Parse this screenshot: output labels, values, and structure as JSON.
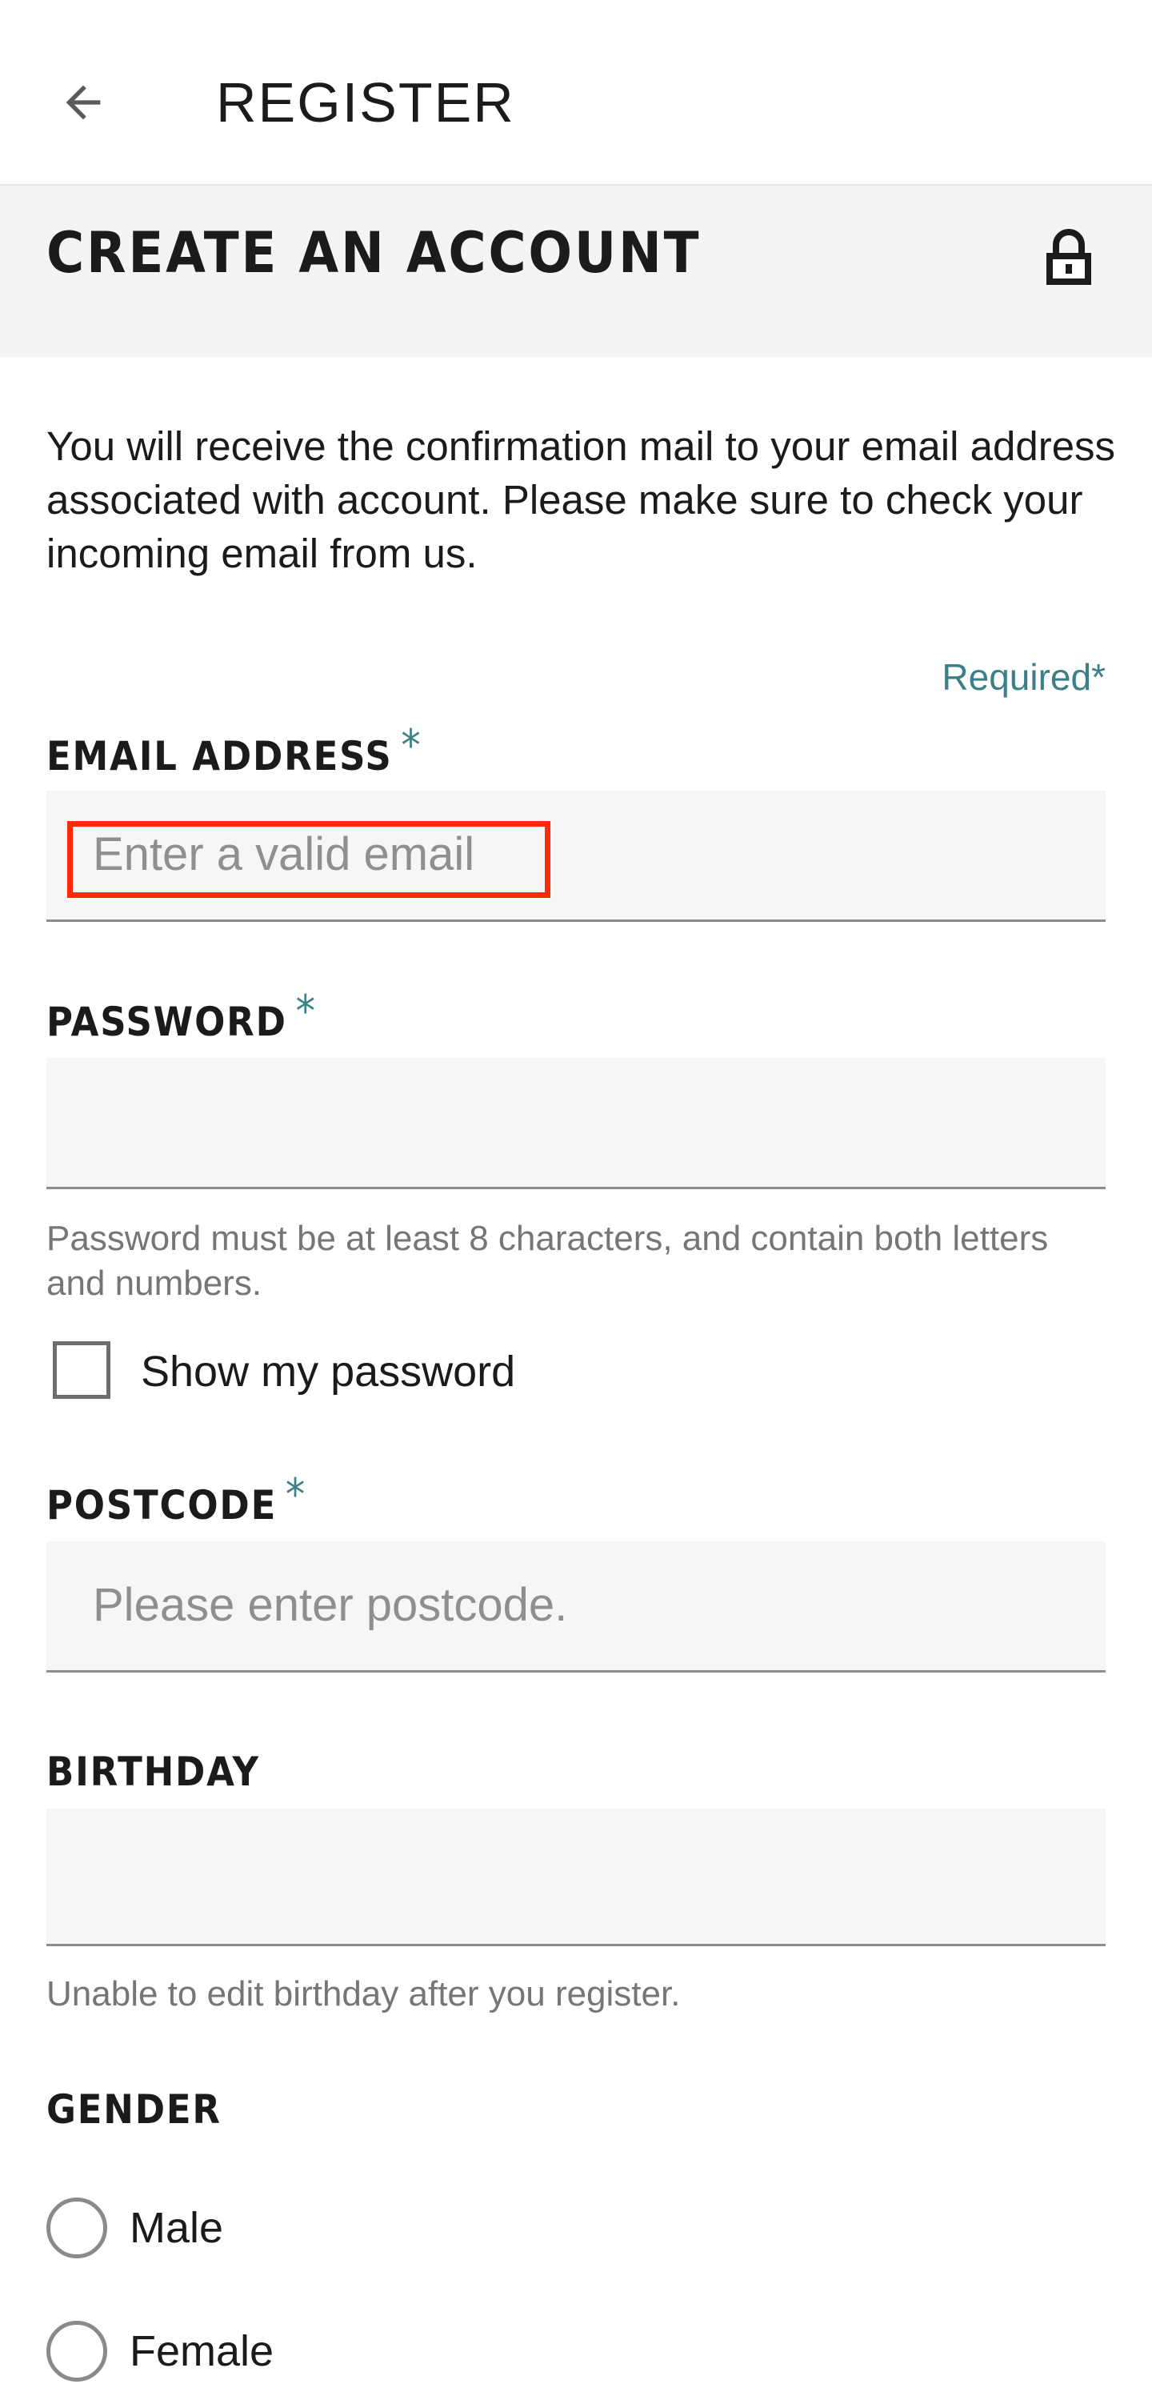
{
  "appbar": {
    "title": "REGISTER",
    "back_icon": "arrow-left-icon"
  },
  "section": {
    "title": "CREATE AN ACCOUNT",
    "icon": "lock-icon"
  },
  "intro": "You will receive the confirmation mail to your email address associated with account. Please make sure to check your incoming email from us.",
  "required_note": "Required*",
  "form": {
    "email": {
      "label": "EMAIL ADDRESS",
      "required_mark": "*",
      "placeholder": "Enter a valid email",
      "value": ""
    },
    "password": {
      "label": "PASSWORD",
      "required_mark": "*",
      "placeholder": "",
      "value": "",
      "hint": "Password must be at least 8 characters, and contain both letters and numbers.",
      "show_password_label": "Show my password",
      "show_password_checked": false
    },
    "postcode": {
      "label": "POSTCODE",
      "required_mark": "*",
      "placeholder": "Please enter postcode.",
      "value": ""
    },
    "birthday": {
      "label": "BIRTHDAY",
      "value": "",
      "hint": "Unable to edit birthday after you register."
    },
    "gender": {
      "label": "GENDER",
      "options": [
        "Male",
        "Female"
      ],
      "selected": null
    }
  },
  "colors": {
    "accent": "#3d7f87",
    "highlight": "#ff2a0a",
    "field_bg": "#f6f6f6",
    "header_bg": "#f4f4f4"
  }
}
